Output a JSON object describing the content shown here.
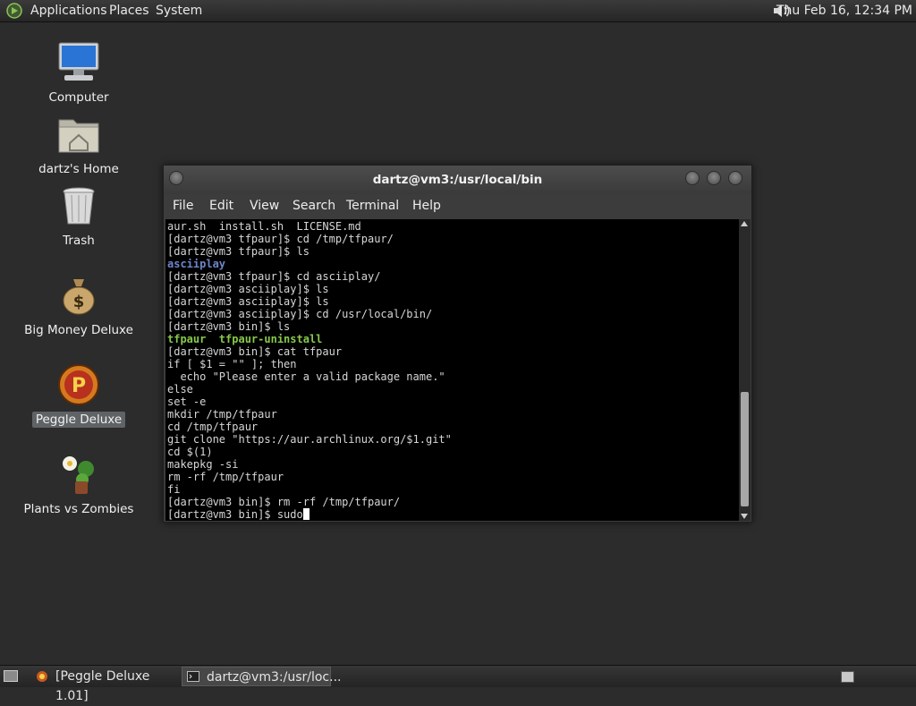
{
  "top_panel": {
    "menus": [
      "Applications",
      "Places",
      "System"
    ],
    "clock": "Thu Feb 16, 12:34 PM"
  },
  "desktop": {
    "icons": [
      {
        "label": "Computer"
      },
      {
        "label": "dartz's Home"
      },
      {
        "label": "Trash"
      },
      {
        "label": "Big Money Deluxe"
      },
      {
        "label": "Peggle Deluxe"
      },
      {
        "label": "Plants vs Zombies"
      }
    ]
  },
  "terminal": {
    "title": "dartz@vm3:/usr/local/bin",
    "menu": [
      "File",
      "Edit",
      "View",
      "Search",
      "Terminal",
      "Help"
    ],
    "lines": [
      "aur.sh  install.sh  LICENSE.md",
      "[dartz@vm3 tfpaur]$ cd /tmp/tfpaur/",
      "[dartz@vm3 tfpaur]$ ls",
      "asciiplay",
      "[dartz@vm3 tfpaur]$ cd asciiplay/",
      "[dartz@vm3 asciiplay]$ ls",
      "[dartz@vm3 asciiplay]$ ls",
      "[dartz@vm3 asciiplay]$ cd /usr/local/bin/",
      "[dartz@vm3 bin]$ ls",
      "tfpaur  tfpaur-uninstall",
      "[dartz@vm3 bin]$ cat tfpaur",
      "if [ $1 = \"\" ]; then",
      "  echo \"Please enter a valid package name.\"",
      "else",
      "set -e",
      "mkdir /tmp/tfpaur",
      "cd /tmp/tfpaur",
      "git clone \"https://aur.archlinux.org/$1.git\"",
      "cd $(1)",
      "makepkg -si",
      "rm -rf /tmp/tfpaur",
      "fi",
      "[dartz@vm3 bin]$ rm -rf /tmp/tfpaur/",
      "[dartz@vm3 bin]$ sudo"
    ]
  },
  "taskbar": {
    "tasks": [
      "[Peggle Deluxe 1.01]",
      "dartz@vm3:/usr/loc..."
    ]
  },
  "colors": {
    "desktop_bg": "#2b2c2b",
    "terminal_bg": "#000000",
    "dir_blue": "#6e86c8",
    "exec_green": "#88c84a"
  }
}
